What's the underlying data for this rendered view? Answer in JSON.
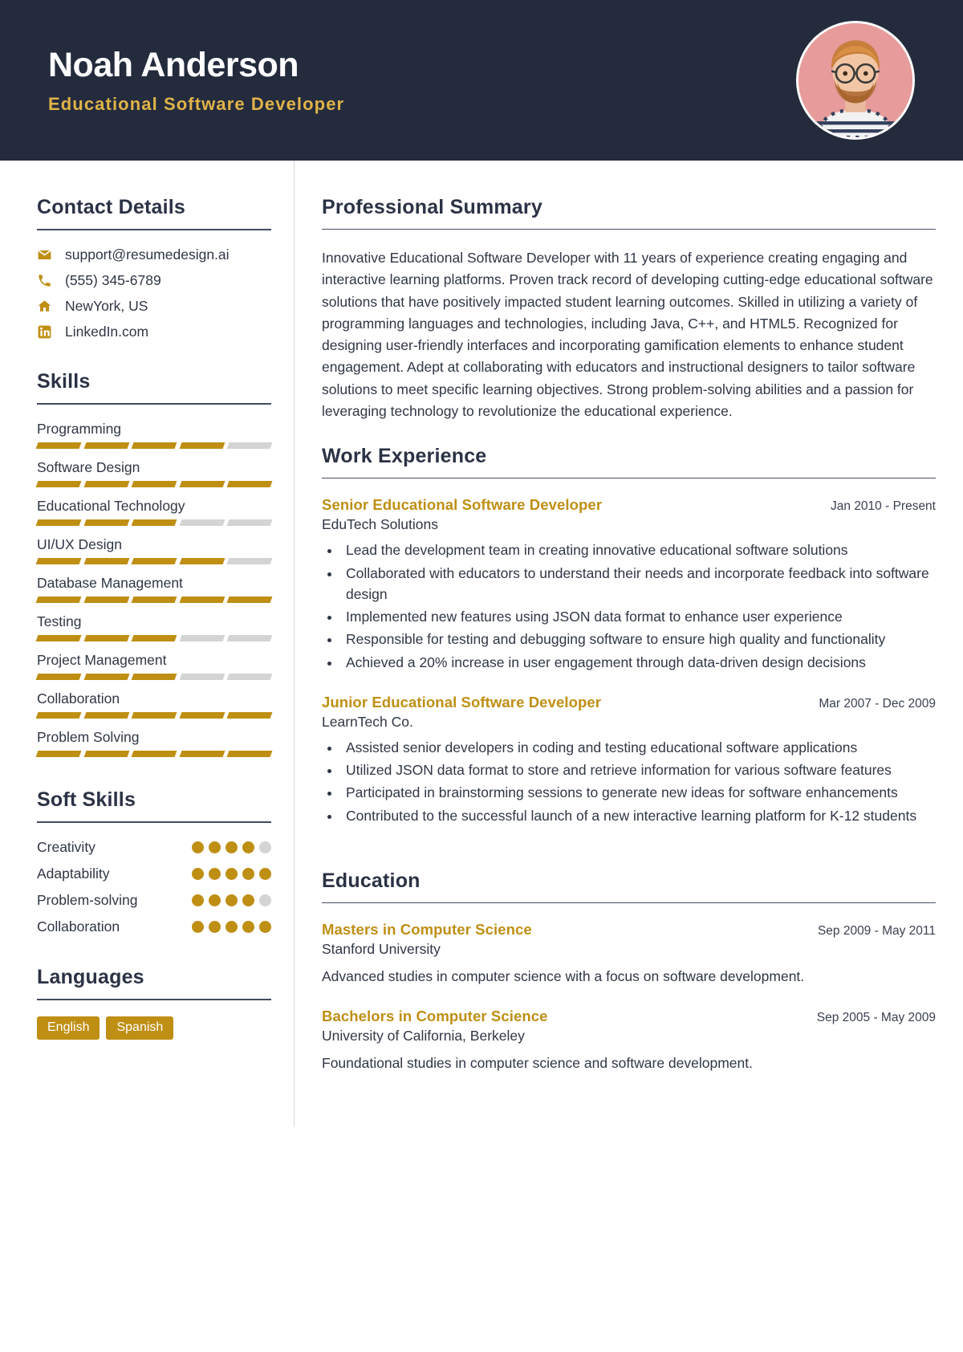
{
  "header": {
    "name": "Noah Anderson",
    "job_title": "Educational Software Developer",
    "avatar_icon": "user-photo"
  },
  "colors": {
    "header_bg": "#232b3d",
    "accent_gold": "#bf8f14",
    "title_gold": "#e0b348",
    "text": "#2f3645",
    "muted_bar": "#d4d4d4"
  },
  "sidebar": {
    "contact": {
      "heading": "Contact Details",
      "items": [
        {
          "icon": "envelope-icon",
          "value": "support@resumedesign.ai"
        },
        {
          "icon": "phone-icon",
          "value": "(555) 345-6789"
        },
        {
          "icon": "home-icon",
          "value": "NewYork, US"
        },
        {
          "icon": "linkedin-icon",
          "value": "LinkedIn.com"
        }
      ]
    },
    "skills": {
      "heading": "Skills",
      "max": 5,
      "items": [
        {
          "label": "Programming",
          "level": 4
        },
        {
          "label": "Software Design",
          "level": 5
        },
        {
          "label": "Educational Technology",
          "level": 3
        },
        {
          "label": "UI/UX Design",
          "level": 4
        },
        {
          "label": "Database Management",
          "level": 5
        },
        {
          "label": "Testing",
          "level": 3
        },
        {
          "label": "Project Management",
          "level": 3
        },
        {
          "label": "Collaboration",
          "level": 5
        },
        {
          "label": "Problem Solving",
          "level": 5
        }
      ]
    },
    "soft_skills": {
      "heading": "Soft Skills",
      "max": 5,
      "items": [
        {
          "label": "Creativity",
          "level": 4
        },
        {
          "label": "Adaptability",
          "level": 5
        },
        {
          "label": "Problem-solving",
          "level": 4
        },
        {
          "label": "Collaboration",
          "level": 5
        }
      ]
    },
    "languages": {
      "heading": "Languages",
      "items": [
        "English",
        "Spanish"
      ]
    }
  },
  "main": {
    "summary": {
      "heading": "Professional Summary",
      "text": "Innovative Educational Software Developer with 11 years of experience creating engaging and interactive learning platforms. Proven track record of developing cutting-edge educational software solutions that have positively impacted student learning outcomes. Skilled in utilizing a variety of programming languages and technologies, including Java, C++, and HTML5. Recognized for designing user-friendly interfaces and incorporating gamification elements to enhance student engagement. Adept at collaborating with educators and instructional designers to tailor software solutions to meet specific learning objectives. Strong problem-solving abilities and a passion for leveraging technology to revolutionize the educational experience."
    },
    "work_experience": {
      "heading": "Work Experience",
      "entries": [
        {
          "role": "Senior Educational Software Developer",
          "date": "Jan 2010 - Present",
          "organization": "EduTech Solutions",
          "bullets": [
            "Lead the development team in creating innovative educational software solutions",
            "Collaborated with educators to understand their needs and incorporate feedback into software design",
            "Implemented new features using JSON data format to enhance user experience",
            "Responsible for testing and debugging software to ensure high quality and functionality",
            "Achieved a 20% increase in user engagement through data-driven design decisions"
          ]
        },
        {
          "role": "Junior Educational Software Developer",
          "date": "Mar 2007 - Dec 2009",
          "organization": "LearnTech Co.",
          "bullets": [
            "Assisted senior developers in coding and testing educational software applications",
            "Utilized JSON data format to store and retrieve information for various software features",
            "Participated in brainstorming sessions to generate new ideas for software enhancements",
            "Contributed to the successful launch of a new interactive learning platform for K-12 students"
          ]
        }
      ]
    },
    "education": {
      "heading": "Education",
      "entries": [
        {
          "degree": "Masters in Computer Science",
          "date": "Sep 2009 - May 2011",
          "school": "Stanford University",
          "description": "Advanced studies in computer science with a focus on software development."
        },
        {
          "degree": "Bachelors in Computer Science",
          "date": "Sep 2005 - May 2009",
          "school": "University of California, Berkeley",
          "description": "Foundational studies in computer science and software development."
        }
      ]
    }
  }
}
